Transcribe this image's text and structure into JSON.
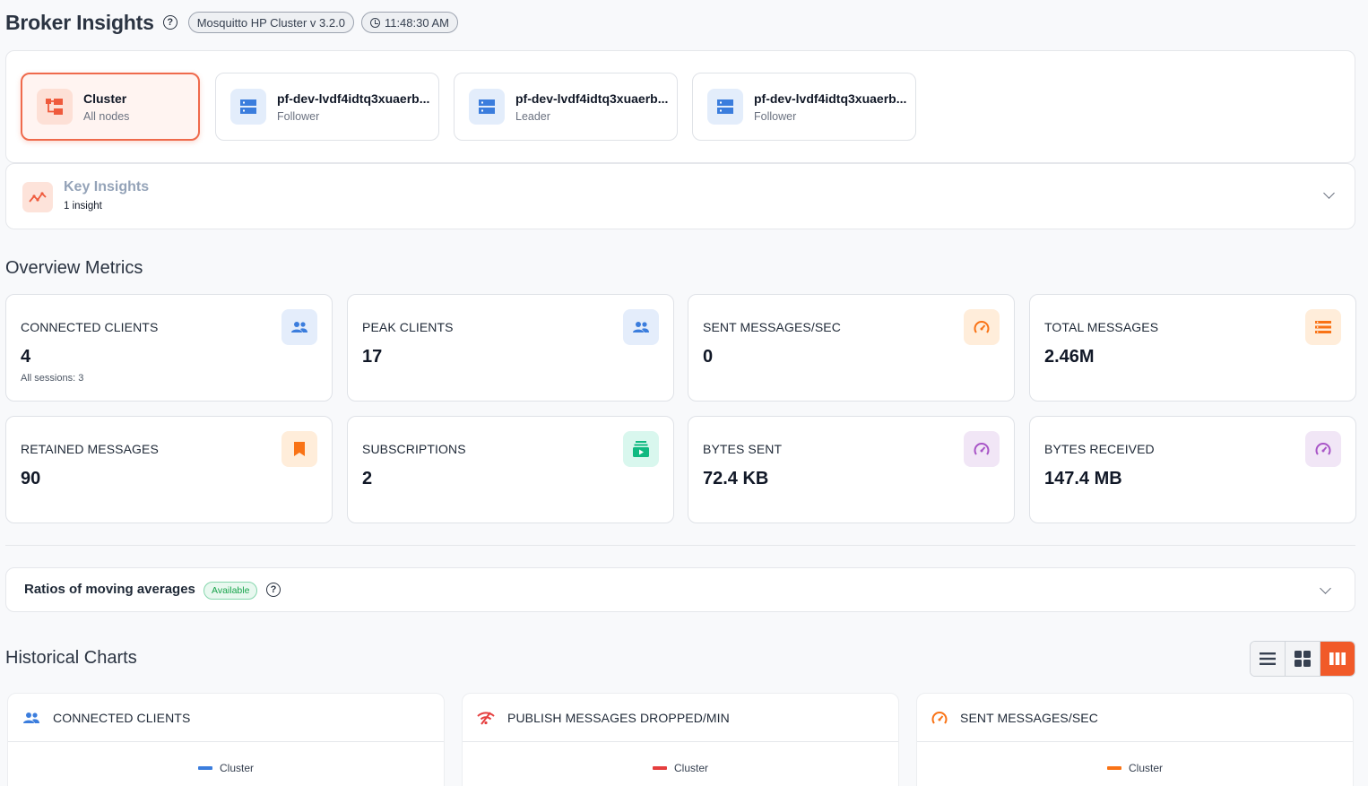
{
  "header": {
    "title": "Broker Insights",
    "version": "Mosquitto HP Cluster v 3.2.0",
    "time": "11:48:30 AM"
  },
  "nodes": [
    {
      "name": "Cluster",
      "role": "All nodes",
      "icon": "cluster-icon",
      "active": true
    },
    {
      "name": "pf-dev-lvdf4idtq3xuaerb...",
      "role": "Follower",
      "icon": "server-icon"
    },
    {
      "name": "pf-dev-lvdf4idtq3xuaerb...",
      "role": "Leader",
      "icon": "server-icon"
    },
    {
      "name": "pf-dev-lvdf4idtq3xuaerb...",
      "role": "Follower",
      "icon": "server-icon"
    }
  ],
  "insights": {
    "title": "Key Insights",
    "subtitle": "1 insight"
  },
  "overview": {
    "title": "Overview Metrics",
    "metrics": [
      {
        "label": "CONNECTED CLIENTS",
        "value": "4",
        "sub": "All sessions: 3",
        "icon": "users-icon",
        "color": "#3b7ddd"
      },
      {
        "label": "PEAK CLIENTS",
        "value": "17",
        "icon": "users-icon",
        "color": "#3b7ddd"
      },
      {
        "label": "SENT MESSAGES/SEC",
        "value": "0",
        "icon": "speedometer-icon",
        "color": "#f97316"
      },
      {
        "label": "TOTAL MESSAGES",
        "value": "2.46M",
        "icon": "list-icon",
        "color": "#f97316"
      },
      {
        "label": "RETAINED MESSAGES",
        "value": "90",
        "icon": "bookmark-icon",
        "color": "#f97316"
      },
      {
        "label": "SUBSCRIPTIONS",
        "value": "2",
        "icon": "subscriptions-icon",
        "color": "#10b981"
      },
      {
        "label": "BYTES SENT",
        "value": "72.4 KB",
        "icon": "speedometer-icon",
        "color": "#a855c7"
      },
      {
        "label": "BYTES RECEIVED",
        "value": "147.4 MB",
        "icon": "speedometer-icon",
        "color": "#a855c7"
      }
    ]
  },
  "ratios": {
    "title": "Ratios of moving averages",
    "badge": "Available"
  },
  "historical": {
    "title": "Historical Charts",
    "charts": [
      {
        "title": "CONNECTED CLIENTS",
        "icon": "users-icon",
        "legend": "Cluster",
        "color": "#3b7ddd"
      },
      {
        "title": "PUBLISH MESSAGES DROPPED/MIN",
        "icon": "wifi-off-icon",
        "legend": "Cluster",
        "color": "#e53e3e"
      },
      {
        "title": "SENT MESSAGES/SEC",
        "icon": "speedometer-icon",
        "legend": "Cluster",
        "color": "#f97316"
      }
    ]
  }
}
